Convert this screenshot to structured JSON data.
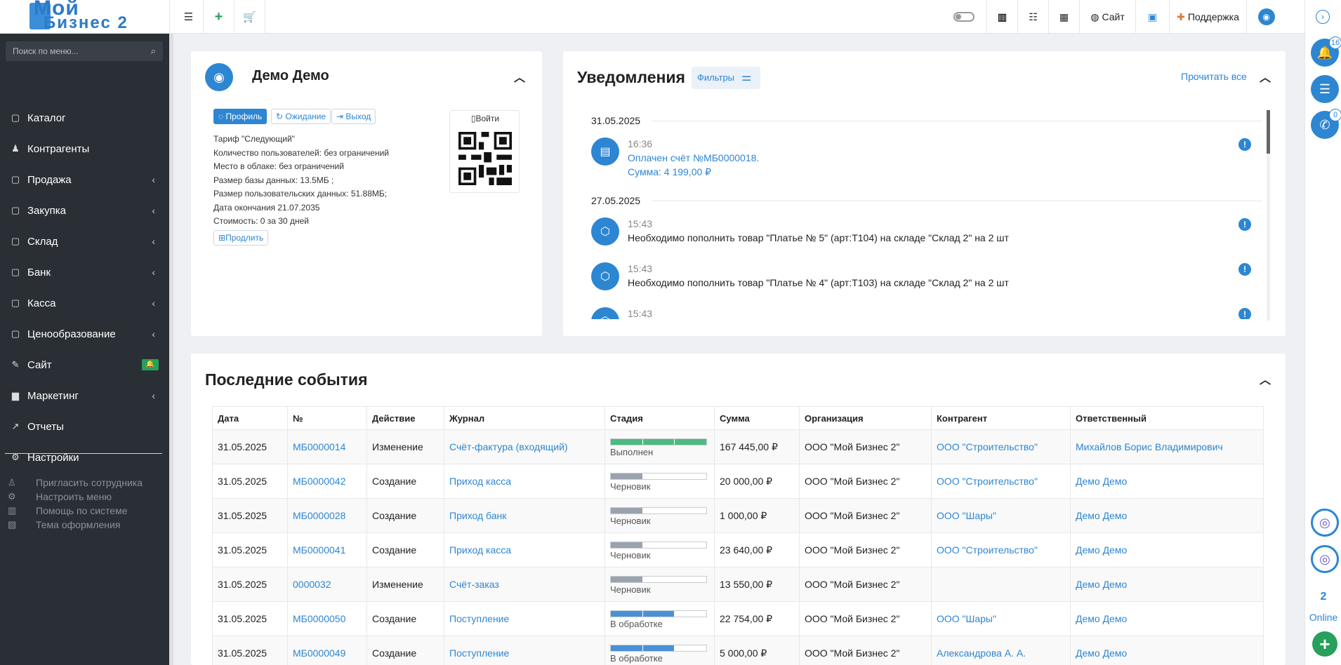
{
  "topbar": {
    "logo_line1": "Мой",
    "logo_line2": "Бизнес 2",
    "site_label": "Сайт",
    "support_label": "Поддержка"
  },
  "sidebar": {
    "search_placeholder": "Поиск по меню...",
    "items": [
      {
        "label": "Каталог",
        "icon": "folder-icon",
        "has_arrow": false
      },
      {
        "label": "Контрагенты",
        "icon": "users-icon",
        "has_arrow": false
      },
      {
        "label": "Продажа",
        "icon": "folder-icon",
        "has_arrow": true
      },
      {
        "label": "Закупка",
        "icon": "folder-icon",
        "has_arrow": true
      },
      {
        "label": "Склад",
        "icon": "folder-icon",
        "has_arrow": true
      },
      {
        "label": "Банк",
        "icon": "folder-icon",
        "has_arrow": true
      },
      {
        "label": "Касса",
        "icon": "folder-icon",
        "has_arrow": true
      },
      {
        "label": "Ценообразование",
        "icon": "folder-icon",
        "has_arrow": true
      },
      {
        "label": "Сайт",
        "icon": "magic-wand-icon",
        "has_arrow": false
      },
      {
        "label": "Маркетинг",
        "icon": "chart-bar-icon",
        "has_arrow": true
      },
      {
        "label": "Отчеты",
        "icon": "chart-line-icon",
        "has_arrow": false
      },
      {
        "label": "Настройки",
        "icon": "gear-icon",
        "has_arrow": false
      }
    ],
    "bottom_links": [
      {
        "label": "Пригласить сотрудника",
        "icon": "user-plus-icon"
      },
      {
        "label": "Настроить меню",
        "icon": "gears-icon"
      },
      {
        "label": "Помощь по системе",
        "icon": "book-icon"
      },
      {
        "label": "Тема оформления",
        "icon": "image-icon"
      }
    ]
  },
  "profile": {
    "name": "Демо Демо",
    "buttons": [
      "Профиль",
      "Ожидание",
      "Выход"
    ],
    "lines": [
      "Тариф \"Следующий\"",
      "Количество пользователей: без ограничений",
      "Место в облаке: без ограничений",
      "Размер базы данных: 13.5МБ ;",
      "Размер пользовательских данных: 51.88МБ;",
      "Дата окончания 21.07.2035",
      "Стоимость: 0 за 30 дней"
    ],
    "extend_label": "Продлить",
    "login_label": "Войти"
  },
  "notifications": {
    "title": "Уведомления",
    "filters_label": "Фильтры",
    "read_all_label": "Прочитать все",
    "dates": [
      "31.05.2025",
      "27.05.2025"
    ],
    "items": [
      {
        "time": "16:36",
        "line1": "Оплачен счёт №МБ0000018.",
        "line2": "Сумма: 4 199,00 ₽"
      },
      {
        "time": "15:43",
        "text": "Необходимо пополнить товар \"Платье № 5\" (арт:Т104) на складе \"Склад 2\" на 2 шт"
      },
      {
        "time": "15:43",
        "text": "Необходимо пополнить товар \"Платье № 4\" (арт:Т103) на складе \"Склад 2\" на 2 шт"
      },
      {
        "time": "15:43",
        "text": ""
      }
    ]
  },
  "events": {
    "title": "Последние события",
    "columns": [
      "Дата",
      "№",
      "Действие",
      "Журнал",
      "Стадия",
      "Сумма",
      "Организация",
      "Контрагент",
      "Ответственный"
    ],
    "rows": [
      {
        "date": "31.05.2025",
        "num": "МБ0000014",
        "action": "Изменение",
        "journal": "Счёт-фактура (входящий)",
        "stage": "Выполнен",
        "stage_level": 3,
        "stage_color": "#4cbb7f",
        "sum": "167 445,00 ₽",
        "org": "ООО \"Мой Бизнес 2\"",
        "contractor": "ООО \"Строительство\"",
        "responsible": "Михайлов Борис Владимирович"
      },
      {
        "date": "31.05.2025",
        "num": "МБ0000042",
        "action": "Создание",
        "journal": "Приход касса",
        "stage": "Черновик",
        "stage_level": 1,
        "stage_color": "#9aa3ad",
        "sum": "20 000,00 ₽",
        "org": "ООО \"Мой Бизнес 2\"",
        "contractor": "ООО \"Строительство\"",
        "responsible": "Демо Демо"
      },
      {
        "date": "31.05.2025",
        "num": "МБ0000028",
        "action": "Создание",
        "journal": "Приход банк",
        "stage": "Черновик",
        "stage_level": 1,
        "stage_color": "#9aa3ad",
        "sum": "1 000,00 ₽",
        "org": "ООО \"Мой Бизнес 2\"",
        "contractor": "ООО \"Шары\"",
        "responsible": "Демо Демо"
      },
      {
        "date": "31.05.2025",
        "num": "МБ0000041",
        "action": "Создание",
        "journal": "Приход касса",
        "stage": "Черновик",
        "stage_level": 1,
        "stage_color": "#9aa3ad",
        "sum": "23 640,00 ₽",
        "org": "ООО \"Мой Бизнес 2\"",
        "contractor": "ООО \"Строительство\"",
        "responsible": "Демо Демо"
      },
      {
        "date": "31.05.2025",
        "num": "0000032",
        "action": "Изменение",
        "journal": "Счёт-заказ",
        "stage": "Черновик",
        "stage_level": 1,
        "stage_color": "#9aa3ad",
        "sum": "13 550,00 ₽",
        "org": "ООО \"Мой Бизнес 2\"",
        "contractor": "",
        "responsible": "Демо Демо"
      },
      {
        "date": "31.05.2025",
        "num": "МБ0000050",
        "action": "Создание",
        "journal": "Поступление",
        "stage": "В обработке",
        "stage_level": 2,
        "stage_color": "#4a90d9",
        "sum": "22 754,00 ₽",
        "org": "ООО \"Мой Бизнес 2\"",
        "contractor": "ООО \"Шары\"",
        "responsible": "Демо Демо"
      },
      {
        "date": "31.05.2025",
        "num": "МБ0000049",
        "action": "Создание",
        "journal": "Поступление",
        "stage": "В обработке",
        "stage_level": 2,
        "stage_color": "#4a90d9",
        "sum": "5 000,00 ₽",
        "org": "ООО \"Мой Бизнес 2\"",
        "contractor": "Александрова А. А.",
        "responsible": "Демо Демо"
      }
    ]
  },
  "rightbar": {
    "notif_count": "16",
    "phone_count": "0",
    "online_count": "2",
    "online_label": "Online"
  }
}
